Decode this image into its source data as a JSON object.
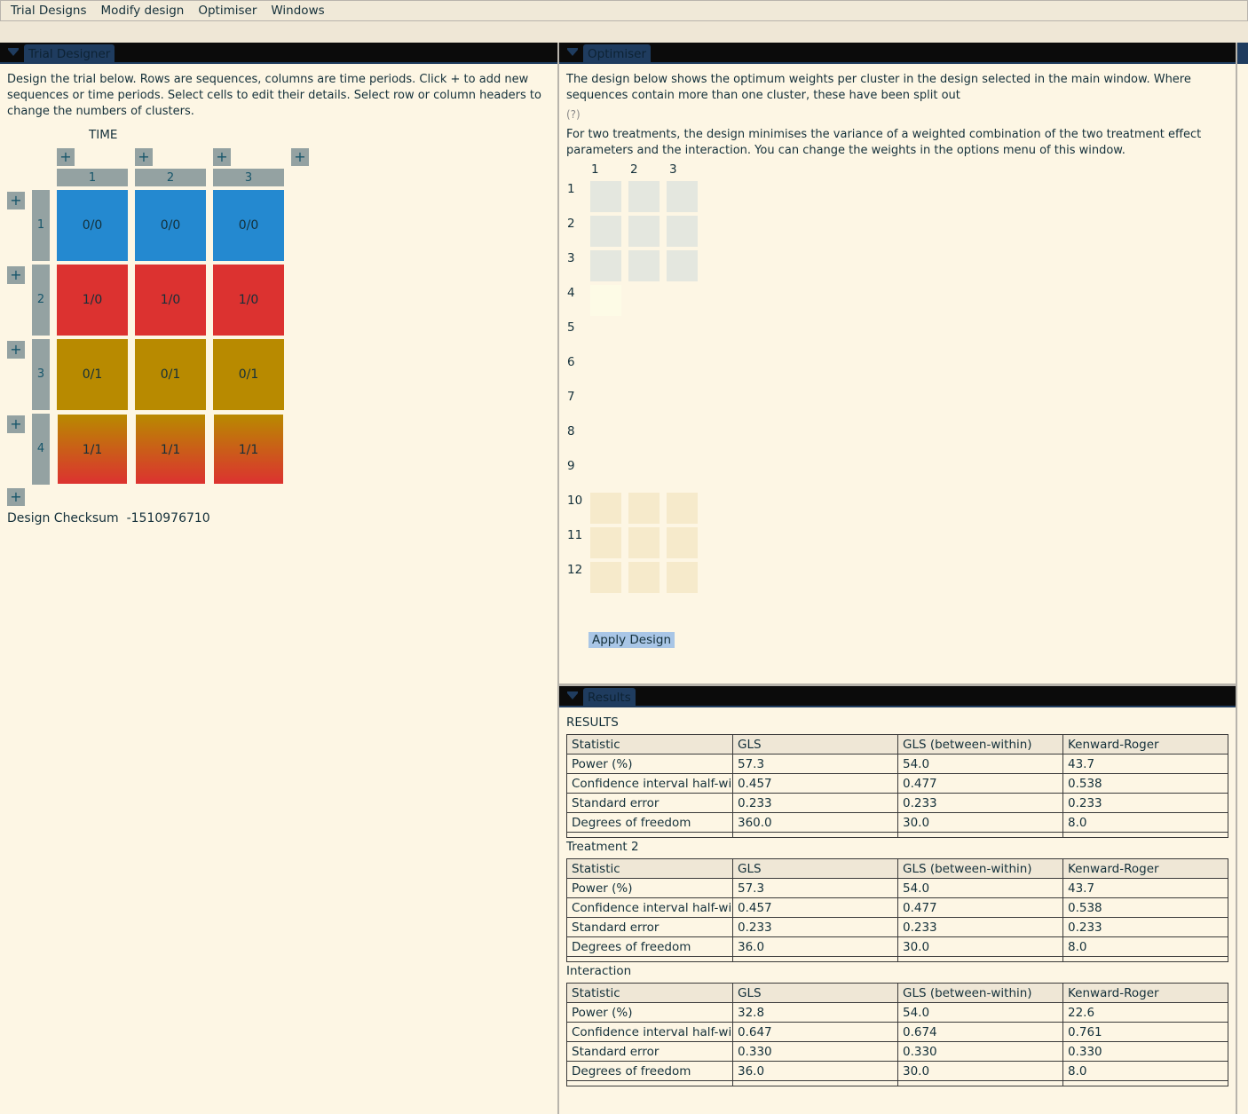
{
  "menu": [
    "Trial Designs",
    "Modify design",
    "Optimiser",
    "Windows"
  ],
  "designer": {
    "tab": "Trial Designer",
    "intro": "Design the trial below. Rows are sequences, columns are time periods. Click + to add new sequences or time periods. Select cells to edit their details. Select row or column headers to change the numbers of clusters.",
    "time_label": "TIME",
    "columns": [
      "1",
      "2",
      "3"
    ],
    "rows": [
      {
        "label": "1",
        "cells": [
          "0/0",
          "0/0",
          "0/0"
        ],
        "color": "#2489d0"
      },
      {
        "label": "2",
        "cells": [
          "1/0",
          "1/0",
          "1/0"
        ],
        "color": "#dc3230"
      },
      {
        "label": "3",
        "cells": [
          "0/1",
          "0/1",
          "0/1"
        ],
        "color": "#b88a00"
      },
      {
        "label": "4",
        "cells": [
          "1/1",
          "1/1",
          "1/1"
        ],
        "color": "gradient:#b88a00-#dc3230"
      }
    ],
    "plus_label": "+",
    "checksum_label": "Design Checksum",
    "checksum_value": "-1510976710"
  },
  "optimiser": {
    "tab": "Optimiser",
    "intro": "The design below shows the optimum weights per cluster in the design selected in the main window. Where sequences contain more than one cluster, these have been split out",
    "help": "(?)",
    "note": "For two treatments, the design minimises the variance of a weighted combination of the two treatment effect parameters and the interaction. You can change the weights in the options menu of this window.",
    "columns": [
      "1",
      "2",
      "3"
    ],
    "rows": [
      "1",
      "2",
      "3",
      "4",
      "5",
      "6",
      "7",
      "8",
      "9",
      "10",
      "11",
      "12"
    ],
    "cell_colors": {
      "1": "#e4e7df",
      "2": "#e4e7df",
      "3": "#e4e7df",
      "4": "#fdfbe6",
      "10": "#f6eacb",
      "11": "#f6eacb",
      "12": "#f6eacb"
    },
    "apply_label": "Apply Design"
  },
  "results": {
    "tab": "Results",
    "sections": [
      {
        "title": "RESULTS",
        "header": [
          "Statistic",
          "GLS",
          "GLS (between-within)",
          "Kenward-Roger"
        ],
        "rows": [
          [
            "Power (%)",
            "57.3",
            "54.0",
            "43.7"
          ],
          [
            "Confidence interval half-width",
            "0.457",
            "0.477",
            "0.538"
          ],
          [
            "Standard error",
            "0.233",
            "0.233",
            "0.233"
          ],
          [
            "Degrees of freedom",
            "360.0",
            "30.0",
            "8.0"
          ]
        ]
      },
      {
        "title": "Treatment 2",
        "header": [
          "Statistic",
          "GLS",
          "GLS (between-within)",
          "Kenward-Roger"
        ],
        "rows": [
          [
            "Power (%)",
            "57.3",
            "54.0",
            "43.7"
          ],
          [
            "Confidence interval half-width",
            "0.457",
            "0.477",
            "0.538"
          ],
          [
            "Standard error",
            "0.233",
            "0.233",
            "0.233"
          ],
          [
            "Degrees of freedom",
            "36.0",
            "30.0",
            "8.0"
          ]
        ]
      },
      {
        "title": "Interaction",
        "header": [
          "Statistic",
          "GLS",
          "GLS (between-within)",
          "Kenward-Roger"
        ],
        "rows": [
          [
            "Power (%)",
            "32.8",
            "54.0",
            "22.6"
          ],
          [
            "Confidence interval half-width",
            "0.647",
            "0.674",
            "0.761"
          ],
          [
            "Standard error",
            "0.330",
            "0.330",
            "0.330"
          ],
          [
            "Degrees of freedom",
            "36.0",
            "30.0",
            "8.0"
          ]
        ]
      }
    ]
  }
}
